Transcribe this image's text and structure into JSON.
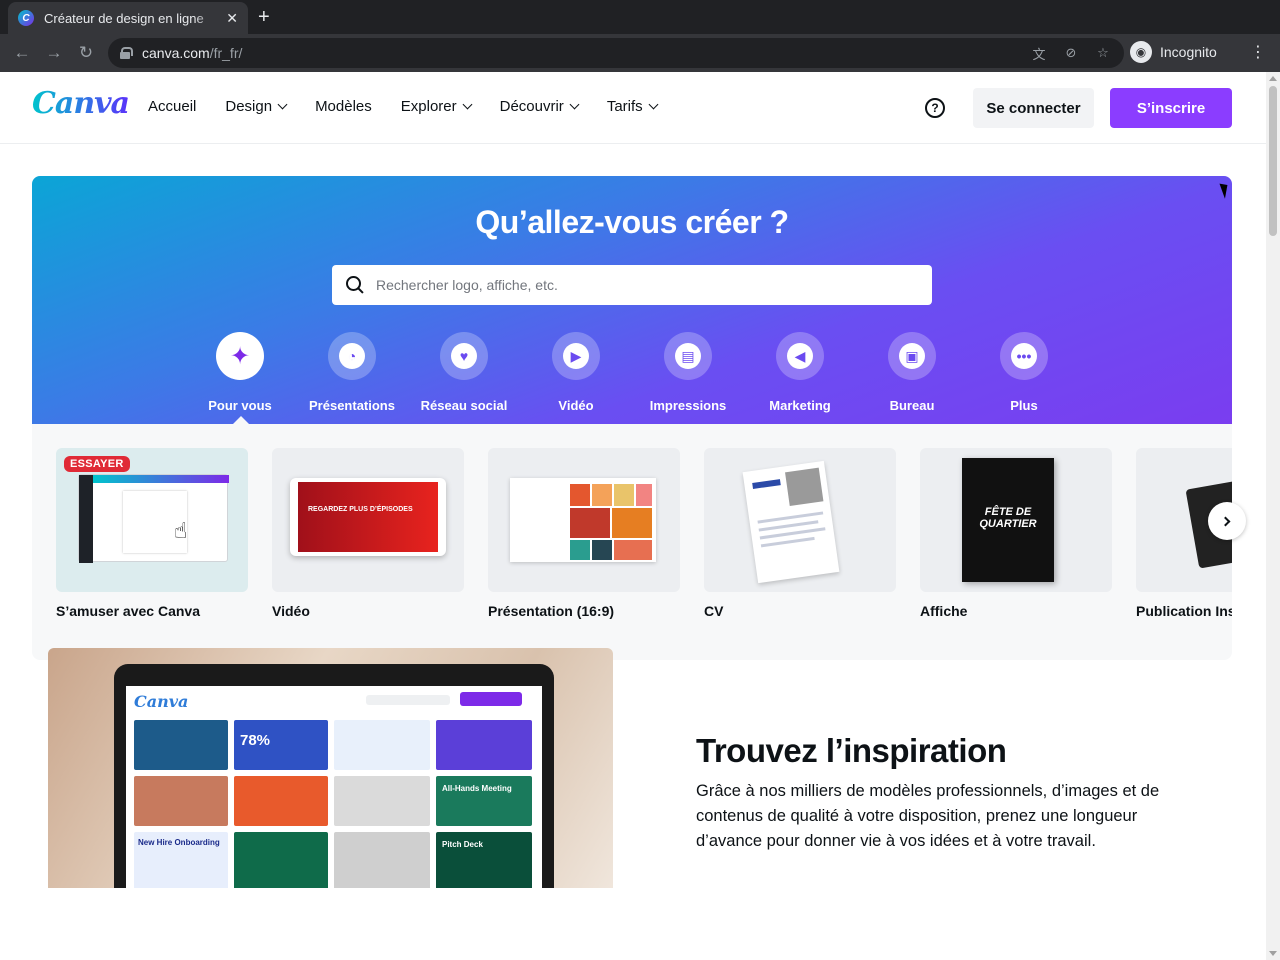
{
  "browser": {
    "tab_title": "Créateur de design en ligne",
    "tab_close": "✕",
    "new_tab": "+",
    "url_host": "canva.com",
    "url_path": "/fr_fr/",
    "profile_label": "Incognito"
  },
  "header": {
    "logo": "Canva",
    "nav": [
      "Accueil",
      "Design",
      "Modèles",
      "Explorer",
      "Découvrir",
      "Tarifs"
    ],
    "help": "?",
    "login": "Se connecter",
    "signup": "S’inscrire"
  },
  "hero": {
    "title": "Qu’allez-vous créer ?",
    "search_placeholder": "Rechercher logo, affiche, etc.",
    "categories": [
      "Pour vous",
      "Présentations",
      "Réseau social",
      "Vidéo",
      "Impressions",
      "Marketing",
      "Bureau",
      "Plus"
    ]
  },
  "templates": {
    "badge": "ESSAYER",
    "cards": [
      "S’amuser avec Canva",
      "Vidéo",
      "Présentation (16:9)",
      "CV",
      "Affiche",
      "Publication Instagram"
    ],
    "video_thumb_text": "REGARDEZ PLUS D’ÉPISODES",
    "poster_thumb_text": "FÊTE DE QUARTIER"
  },
  "inspiration": {
    "title": "Trouvez l’inspiration",
    "text": "Grâce à nos milliers de modèles professionnels, d’images et de contenus de qualité à votre disposition, prenez une longueur d’avance pour donner vie à vos idées et à votre travail.",
    "laptop_logo": "Canva",
    "tile_percent": "78%",
    "tile_onboarding": "New Hire Onboarding",
    "tile_meeting": "All-Hands Meeting",
    "tile_pitch": "Pitch Deck"
  },
  "colors": {
    "brand_purple": "#8b3dff",
    "badge_red": "#e02a36"
  }
}
